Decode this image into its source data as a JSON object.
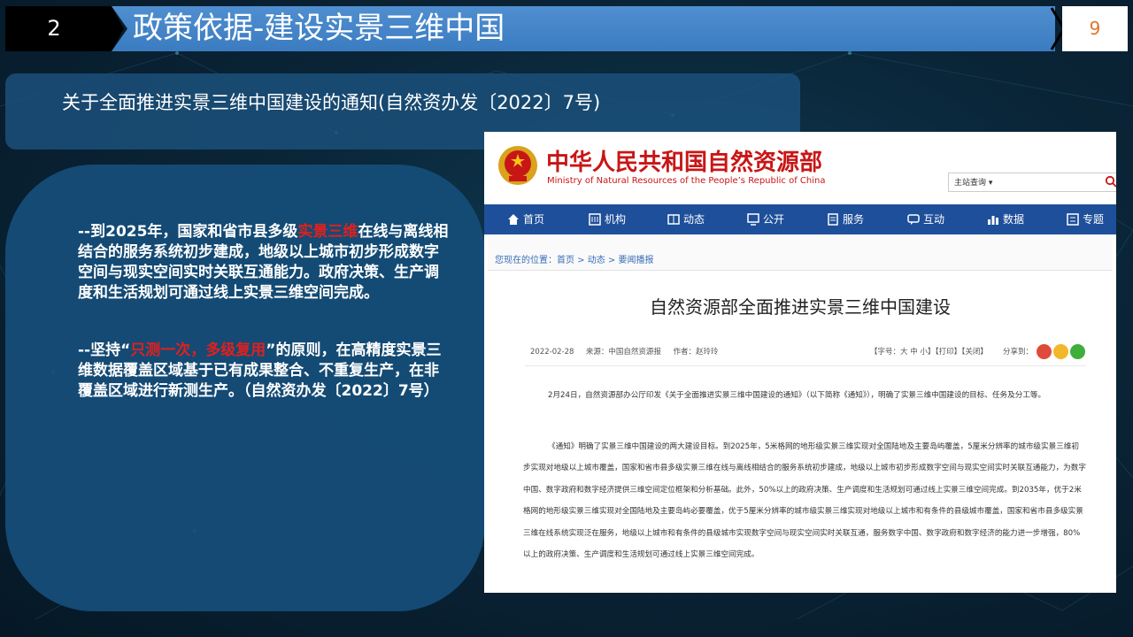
{
  "header": {
    "slide_number": "2",
    "title": "政策依据-建设实景三维中国",
    "page_number": "9"
  },
  "subtitle": "关于全面推进实景三维中国建设的通知(自然资办发〔2022〕7号)",
  "left_panel": {
    "para1_a": "--到2025年，国家和省市县多级",
    "para1_hl": "实景三维",
    "para1_b": "在线与离线相结合的服务系统初步建成，地级以上城市初步形成数字空间与现实空间实时关联互通能力。政府决策、生产调度和生活规划可通过线上实景三维空间完成。",
    "para2_a": "--坚持“",
    "para2_hl": "只测一次，多级复用",
    "para2_b": "”的原则，在高精度实景三维数据覆盖区域基于已有成果整合、不重复生产，在非覆盖区域进行新测生产。（自然资办发〔2022〕7号）"
  },
  "website": {
    "site_name_cn": "中华人民共和国自然资源部",
    "site_name_en": "Ministry of Natural Resources of the People’s Republic of China",
    "search_select": "主站查询",
    "nav": [
      {
        "label": "首页",
        "icon": "home-icon"
      },
      {
        "label": "机构",
        "icon": "org-icon"
      },
      {
        "label": "动态",
        "icon": "news-icon"
      },
      {
        "label": "公开",
        "icon": "open-icon"
      },
      {
        "label": "服务",
        "icon": "service-icon"
      },
      {
        "label": "互动",
        "icon": "chat-icon"
      },
      {
        "label": "数据",
        "icon": "data-icon"
      },
      {
        "label": "专题",
        "icon": "topic-icon"
      }
    ],
    "breadcrumb": "您现在的位置：首页 > 动态 > 要闻播报",
    "article_title": "自然资源部全面推进实景三维中国建设",
    "date": "2022-02-28",
    "source": "来源：中国自然资源报",
    "author": "作者：赵玲玲",
    "tools": "【字号：大 中 小】【打印】【关闭】",
    "share_label": "分享到：",
    "body": [
      "2月24日，自然资源部办公厅印发《关于全面推进实景三维中国建设的通知》（以下简称《通知》），明确了实景三维中国建设的目标、任务及分工等。",
      "《通知》明确了实景三维中国建设的两大建设目标。到2025年，5米格网的地形级实景三维实现对全国陆地及主要岛屿覆盖，5厘米分辨率的城市级实景三维初步实现对地级以上城市覆盖，国家和省市县多级实景三维在线与离线相结合的服务系统初步建成，地级以上城市初步形成数字空间与现实空间实时关联互通能力，为数字中国、数字政府和数字经济提供三维空间定位框架和分析基础。此外，50%以上的政府决策、生产调度和生活规划可通过线上实景三维空间完成。到2035年，优于2米格网的地形级实景三维实现对全国陆地及主要岛屿必要覆盖，优于5厘米分辨率的城市级实景三维实现对地级以上城市和有条件的县级城市覆盖，国家和省市县多级实景三维在线系统实现泛在服务，地级以上城市和有条件的县级城市实现数字空间与现实空间实时关联互通，服务数字中国、数字政府和数字经济的能力进一步增强，80%以上的政府决策、生产调度和生活规划可通过线上实景三维空间完成。"
    ]
  },
  "colors": {
    "header_bar": "#4a8acb",
    "panel": "#1b507a",
    "highlight": "#e0201e",
    "site_red": "#c81616",
    "nav_blue": "#1e4f9a",
    "page_number": "#e0752a"
  }
}
